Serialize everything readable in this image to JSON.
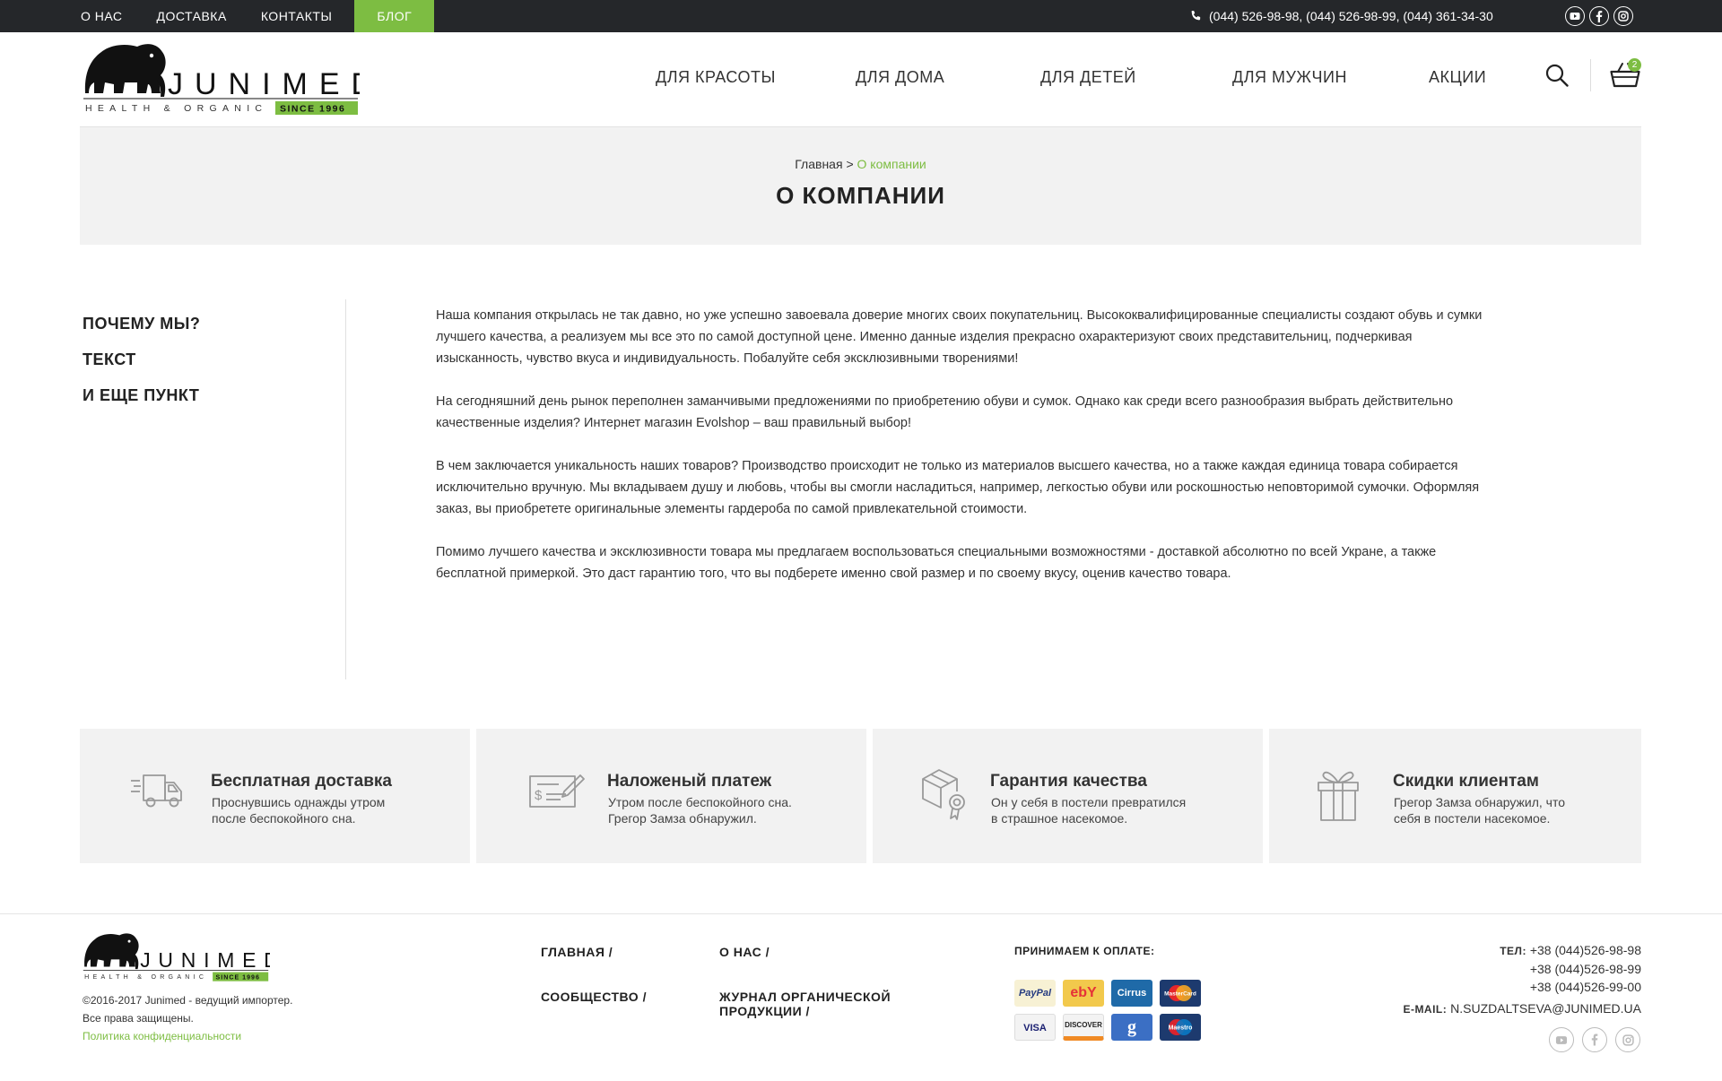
{
  "topbar": {
    "nav": [
      "О НАС",
      "ДОСТАВКА",
      "КОНТАКТЫ",
      "БЛОГ"
    ],
    "active": "БЛОГ",
    "phones": "(044) 526-98-98, (044) 526-98-99, (044) 361-34-30",
    "social_icons": [
      "youtube-icon",
      "facebook-icon",
      "instagram-icon"
    ]
  },
  "brand": {
    "name": "JUNIMED",
    "tagline": "HEALTH & ORGANIC",
    "since": "SINCE 1996",
    "accent_color": "#7dbd42",
    "dark_color": "#25272a"
  },
  "header": {
    "nav": [
      "ДЛЯ КРАСОТЫ",
      "ДЛЯ ДОМА",
      "ДЛЯ ДЕТЕЙ",
      "ДЛЯ МУЖЧИН",
      "АКЦИИ"
    ],
    "cart_count": "2"
  },
  "banner": {
    "breadcrumb_home": "Главная",
    "breadcrumb_sep": ">",
    "breadcrumb_current": "О компании",
    "title": "О КОМПАНИИ"
  },
  "sidemenu": [
    "ПОЧЕМУ МЫ?",
    "ТЕКСТ",
    "И ЕЩЕ ПУНКТ"
  ],
  "article": [
    "Наша компания открылась не так давно, но уже успешно завоевала доверие многих своих покупательниц. Высококвалифицированные специалисты создают обувь и сумки лучшего качества, а реализуем мы все это по самой доступной цене. Именно данные изделия прекрасно охарактеризуют своих представительниц, подчеркивая изысканность, чувство вкуса и индивидуальность. Побалуйте себя эксклюзивными творениями!",
    "На сегодняшний день рынок переполнен заманчивыми предложениями по приобретению обуви и сумок. Однако как среди всего разнообразия выбрать действительно качественные изделия? Интернет магазин Evolshop – ваш правильный выбор!",
    "В чем заключается уникальность наших товаров? Производство происходит не только из материалов высшего качества, но а также каждая единица товара собирается исключительно вручную. Мы вкладываем душу и любовь, чтобы вы смогли насладиться, например, легкостью обуви или роскошностью неповторимой сумочки. Оформляя заказ, вы приобретете оригинальные элементы гардероба по самой привлекательной стоимости.",
    "Помимо лучшего качества и эксклюзивности товара мы предлагаем воспользоваться специальными возможностями - доставкой абсолютно по всей Укране, а также бесплатной примеркой. Это даст гарантию того, что вы подберете именно свой размер и по своему вкусу, оценив качество товара."
  ],
  "features": [
    {
      "icon": "delivery-truck-icon",
      "title": "Бесплатная доставка",
      "desc_1": "Проснувшись однажды утром",
      "desc_2": "после беспокойного сна."
    },
    {
      "icon": "payment-check-icon",
      "title": "Наложеный платеж",
      "desc_1": "Утром после беспокойного сна.",
      "desc_2": "Грегор Замза обнаружил."
    },
    {
      "icon": "quality-box-icon",
      "title": "Гарантия качества",
      "desc_1": "Он у себя в постели превратился",
      "desc_2": "в страшное насекомое."
    },
    {
      "icon": "gift-icon",
      "title": "Скидки клиентам",
      "desc_1": "Грегор Замза обнаружил, что",
      "desc_2": "себя в постели насекомое."
    }
  ],
  "footer": {
    "copyright_1": "©2016-2017 Junimed - ведущий импортер.",
    "copyright_2": "Все права защищены.",
    "policy": "Политика конфиденциальности",
    "links": [
      "ГЛАВНАЯ /",
      "О НАС /",
      "СООБЩЕСТВО /",
      "ЖУРНАЛ ОРГАНИЧЕСКОЙ",
      "ПРОДУКЦИИ /"
    ],
    "payments_title": "ПРИНИМАЕМ К ОПЛАТЕ:",
    "payments": [
      "PayPal",
      "ebY",
      "Cirrus",
      "MasterCard",
      "VISA",
      "DISCOVER",
      "g",
      "Maestro"
    ],
    "tel_label": "ТЕЛ:",
    "phones": [
      "+38 (044)526-98-98",
      "+38 (044)526-98-99",
      "+38 (044)526-99-00"
    ],
    "email_label": "E-MAIL:",
    "email": "N.SUZDALTSEVA@JUNIMED.UA",
    "social_icons": [
      "youtube-icon",
      "facebook-icon",
      "instagram-icon"
    ]
  }
}
